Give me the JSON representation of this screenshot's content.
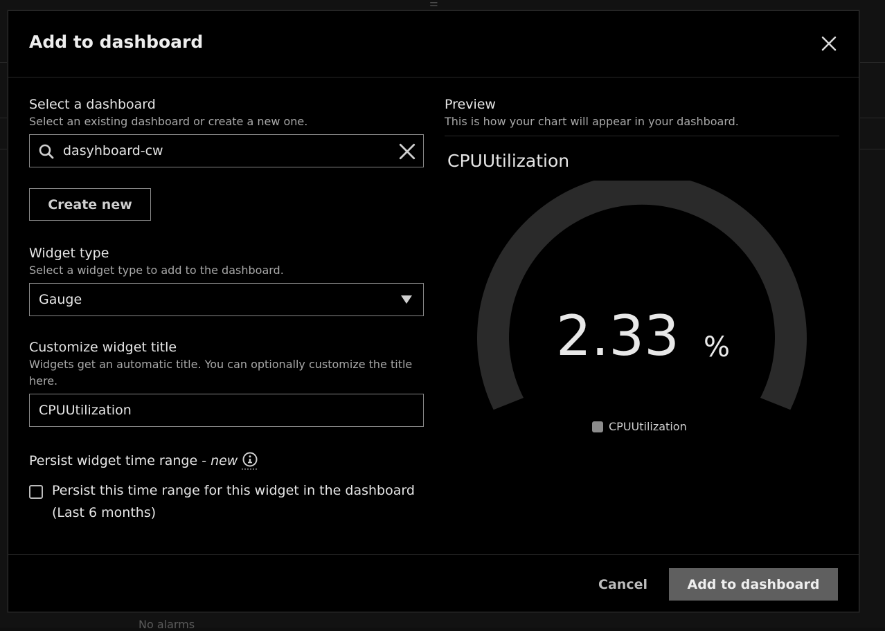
{
  "modal": {
    "title": "Add to dashboard"
  },
  "dashboard": {
    "label": "Select a dashboard",
    "description": "Select an existing dashboard or create a new one.",
    "search_value": "dasyhboard-cw",
    "create_new_label": "Create new"
  },
  "widget_type": {
    "label": "Widget type",
    "description": "Select a widget type to add to the dashboard.",
    "selected": "Gauge"
  },
  "widget_title": {
    "label": "Customize widget title",
    "description": "Widgets get an automatic title. You can optionally customize the title here.",
    "value": "CPUUtilization"
  },
  "persist": {
    "label": "Persist widget time range -",
    "badge": "new",
    "checkbox_label_line1": "Persist this time range for this widget in the dashboard",
    "checkbox_label_line2": "(Last 6 months)",
    "checked": false
  },
  "preview": {
    "label": "Preview",
    "description": "This is how your chart will appear in your dashboard.",
    "chart_title": "CPUUtilization",
    "value": "2.33",
    "unit": "%",
    "legend": "CPUUtilization"
  },
  "footer": {
    "cancel_label": "Cancel",
    "add_label": "Add to dashboard"
  },
  "colors": {
    "gauge_track": "#2a2a2a",
    "legend_swatch": "#8c8c8c",
    "primary_button": "#5f5f5f"
  }
}
